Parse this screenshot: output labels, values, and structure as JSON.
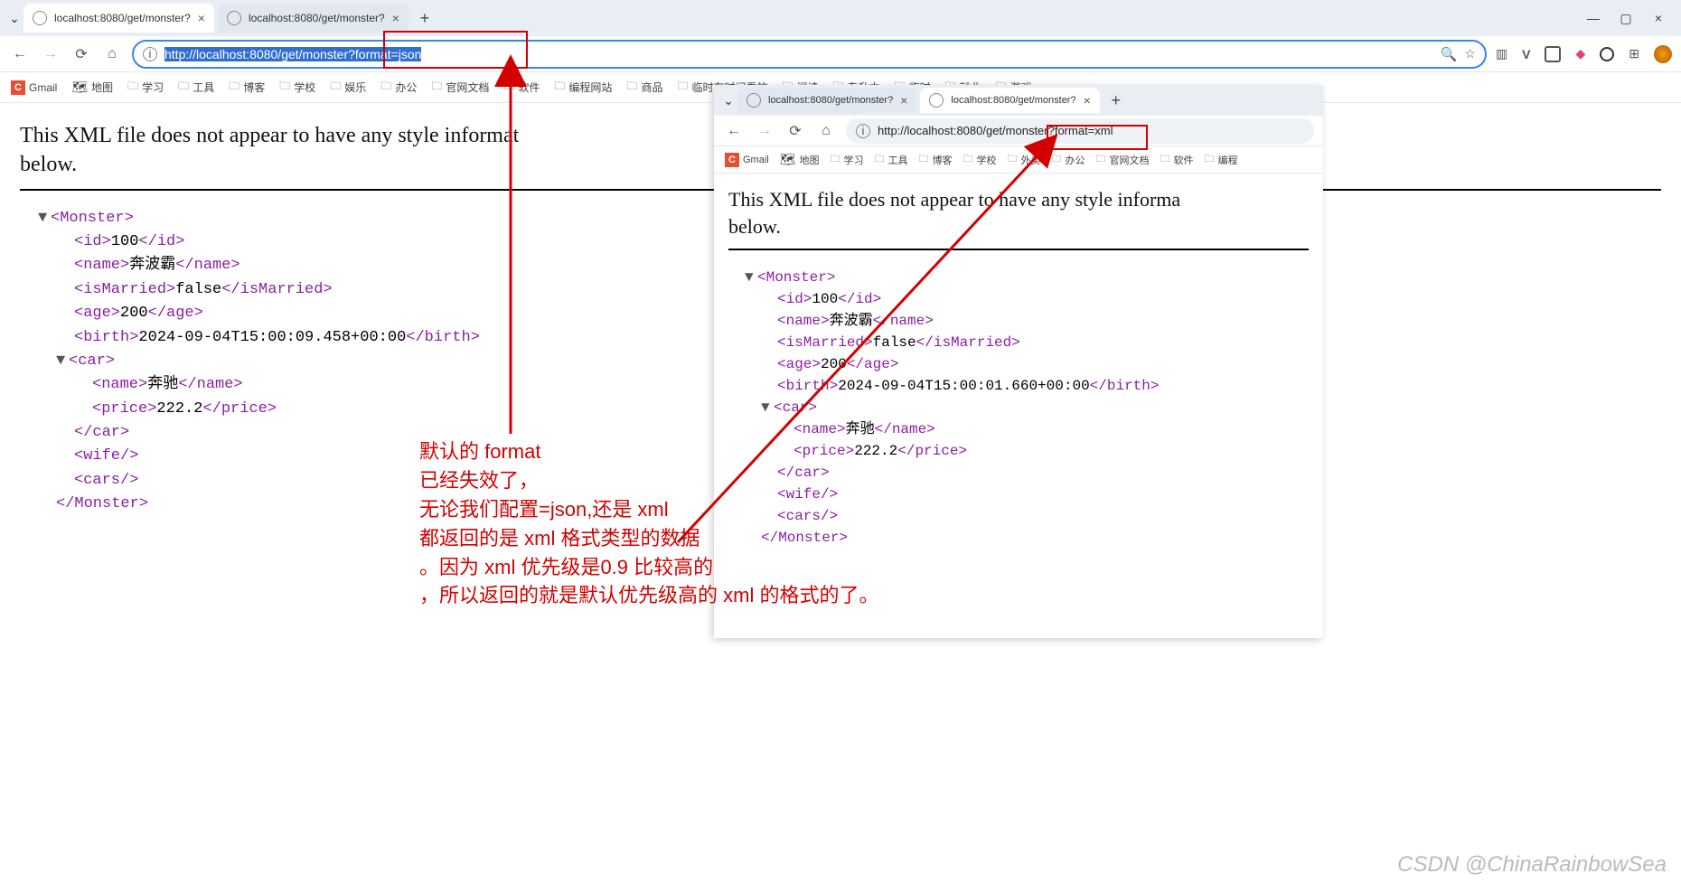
{
  "main": {
    "tabs": [
      {
        "title": "localhost:8080/get/monster?"
      },
      {
        "title": "localhost:8080/get/monster?"
      }
    ],
    "url_prefix": "http://localhost:8080/get/monster",
    "url_suffix": "?format=json",
    "msg_line1": "This XML file does not appear to have any style informat",
    "msg_line2": "below.",
    "xml": {
      "root": "Monster",
      "id": "100",
      "name": "奔波霸",
      "isMarried": "false",
      "age": "200",
      "birth": "2024-09-04T15:00:09.458+00:00",
      "car": {
        "name": "奔驰",
        "price": "222.2"
      }
    }
  },
  "sub": {
    "tabs": [
      {
        "title": "localhost:8080/get/monster?"
      },
      {
        "title": "localhost:8080/get/monster?"
      }
    ],
    "url": "http://localhost:8080/get/monster?format=xml",
    "msg_line1": "This XML file does not appear to have any style informa",
    "msg_line2": "below.",
    "xml": {
      "root": "Monster",
      "id": "100",
      "name": "奔波霸",
      "isMarried": "false",
      "age": "200",
      "birth": "2024-09-04T15:00:01.660+00:00",
      "car": {
        "name": "奔驰",
        "price": "222.2"
      }
    }
  },
  "bookmarks": [
    "Gmail",
    "地图",
    "学习",
    "工具",
    "博客",
    "学校",
    "娱乐",
    "办公",
    "官网文档",
    "软件",
    "编程网站",
    "商品",
    "临时有时间看的",
    "阅读",
    "专升本",
    "临时",
    "就业",
    "游戏"
  ],
  "bookmarks_sub": [
    "Gmail",
    "地图",
    "学习",
    "工具",
    "博客",
    "学校",
    "外卖",
    "办公",
    "官网文档",
    "软件",
    "编程"
  ],
  "annotation": "默认的 format\n已经失效了，\n无论我们配置=json,还是 xml\n都返回的是 xml 格式类型的数据\n。因为 xml 优先级是0.9 比较高的\n，所以返回的就是默认优先级高的 xml 的格式的了。",
  "watermark": "CSDN @ChinaRainbowSea"
}
